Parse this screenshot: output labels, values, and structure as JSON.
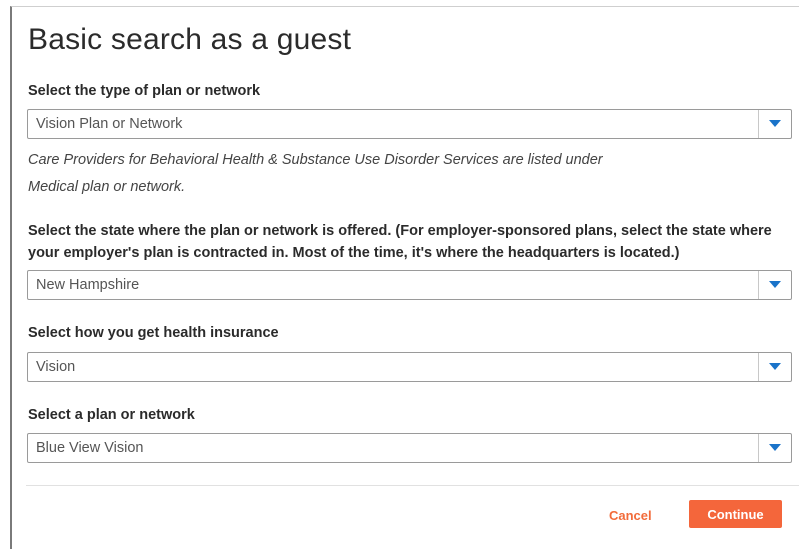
{
  "dialog": {
    "title": "Basic search as a guest"
  },
  "plan_type": {
    "label": "Select the type of plan or network",
    "value": "Vision Plan or Network",
    "note_line1": "Care Providers for Behavioral Health & Substance Use Disorder Services are listed under",
    "note_line2": "Medical plan or network."
  },
  "state": {
    "label": "Select the state where the plan or network is offered. (For employer-sponsored plans, select the state where your employer's plan is contracted in. Most of the time, it's where the headquarters is located.)",
    "value": "New Hampshire"
  },
  "insurance_source": {
    "label": "Select how you get health insurance",
    "value": "Vision"
  },
  "plan": {
    "label": "Select a plan or network",
    "value": "Blue View Vision"
  },
  "footer": {
    "cancel_label": "Cancel",
    "continue_label": "Continue"
  },
  "colors": {
    "accent": "#f4663b",
    "dropdown_arrow": "#1a73c9"
  },
  "icons": {
    "dropdown": "chevron-down-icon"
  }
}
